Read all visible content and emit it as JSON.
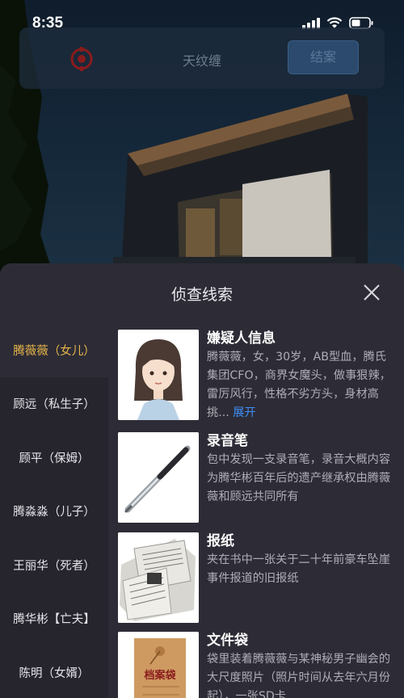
{
  "status_bar": {
    "time": "8:35"
  },
  "top_bar": {
    "title": "天纹缠",
    "close_case_label": "结案"
  },
  "modal": {
    "title": "侦查线索",
    "suspects": [
      {
        "label": "腾薇薇（女儿）",
        "active": true
      },
      {
        "label": "顾远（私生子）"
      },
      {
        "label": "顾平（保姆）"
      },
      {
        "label": "腾淼淼（儿子）"
      },
      {
        "label": "王丽华（死者）"
      },
      {
        "label": "腾华彬【亡夫】"
      },
      {
        "label": "陈明（女婿）"
      }
    ],
    "clues": [
      {
        "name": "嫌疑人信息",
        "desc": "腾薇薇，女，30岁，AB型血，腾氏集团CFO，商界女魔头，做事狠辣，雷厉风行，性格不劣方头，身材高挑...",
        "expand_label": "展开",
        "icon": "suspect-portrait"
      },
      {
        "name": "录音笔",
        "desc": "包中发现一支录音笔，录音大概内容为腾华彬百年后的遗产继承权由腾薇薇和顾远共同所有",
        "icon": "voice-recorder-pen"
      },
      {
        "name": "报纸",
        "desc": "夹在书中一张关于二十年前豪车坠崖事件报道的旧报纸",
        "icon": "newspaper"
      },
      {
        "name": "文件袋",
        "desc": "袋里装着腾薇薇与某神秘男子幽会的大尺度照片（照片时间从去年六月份起），一张SD卡",
        "icon": "file-envelope",
        "envelope_label": "档案袋"
      }
    ]
  },
  "colors": {
    "accent": "#e9b64a",
    "link": "#3f8ef7",
    "modal_bg": "#2d2c36",
    "sidebar_bg": "#26252e"
  }
}
